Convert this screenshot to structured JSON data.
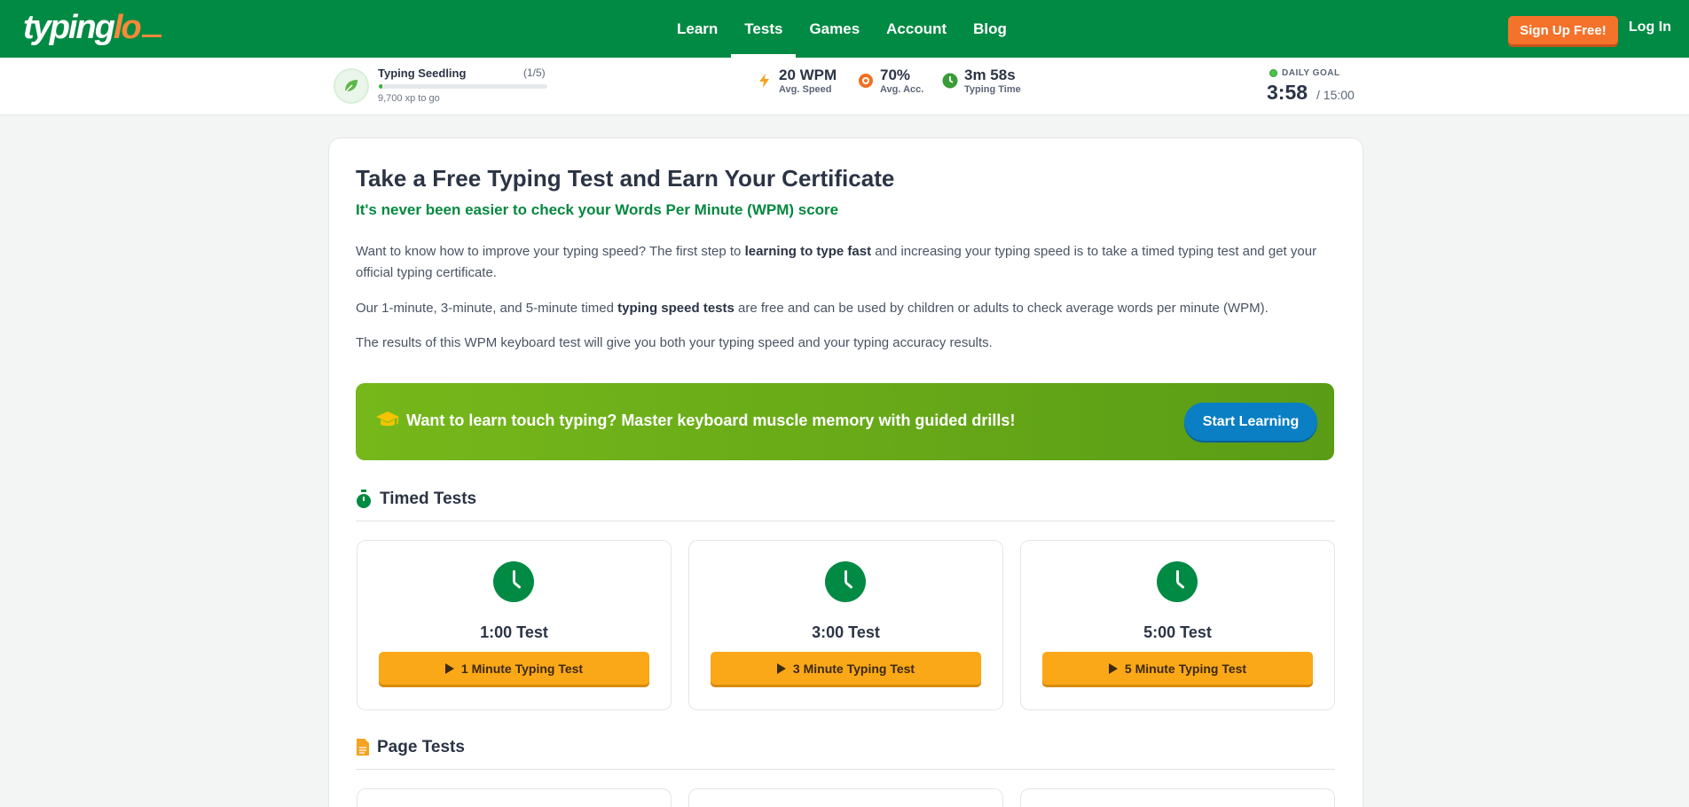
{
  "brand": {
    "logo_part1": "typing",
    "logo_part2": "lo"
  },
  "nav": {
    "items": [
      {
        "label": "Learn",
        "active": false
      },
      {
        "label": "Tests",
        "active": true
      },
      {
        "label": "Games",
        "active": false
      },
      {
        "label": "Account",
        "active": false
      },
      {
        "label": "Blog",
        "active": false
      }
    ],
    "signup_label": "Sign Up Free!",
    "login_label": "Log In"
  },
  "stats": {
    "level": {
      "name": "Typing Seedling",
      "count": "(1/5)",
      "xp_to_go": "9,700 xp to go",
      "progress": 0.02
    },
    "speed": {
      "value": "20 WPM",
      "label": "Avg. Speed"
    },
    "accuracy": {
      "value": "70%",
      "label": "Avg. Acc."
    },
    "time": {
      "value": "3m 58s",
      "label": "Typing Time"
    },
    "goal": {
      "label": "DAILY GOAL",
      "current": "3:58",
      "total": "/ 15:00"
    }
  },
  "main": {
    "title": "Take a Free Typing Test and Earn Your Certificate",
    "subtitle": "It's never been easier to check your Words Per Minute (WPM) score",
    "p1_a": "Want to know how to improve your typing speed? The first step to ",
    "p1_b": "learning to type fast",
    "p1_c": " and increasing your typing speed is to take a timed typing test and get your official typing certificate.",
    "p2_a": "Our 1-minute, 3-minute, and 5-minute timed ",
    "p2_b": "typing speed tests",
    "p2_c": " are free and can be used by children or adults to check average words per minute (WPM).",
    "p3": "The results of this WPM keyboard test will give you both your typing speed and your typing accuracy results."
  },
  "banner": {
    "text": "Want to learn touch typing? Master keyboard muscle memory with guided drills!",
    "button": "Start Learning"
  },
  "timed": {
    "title": "Timed Tests",
    "tests": [
      {
        "name": "1:00 Test",
        "button": "1 Minute Typing Test"
      },
      {
        "name": "3:00 Test",
        "button": "3 Minute Typing Test"
      },
      {
        "name": "5:00 Test",
        "button": "5 Minute Typing Test"
      }
    ]
  },
  "page_tests": {
    "title": "Page Tests"
  },
  "colors": {
    "brand_green": "#008a43",
    "accent_orange": "#f5722b",
    "button_yellow": "#fba818",
    "blue": "#0a7fc4"
  }
}
